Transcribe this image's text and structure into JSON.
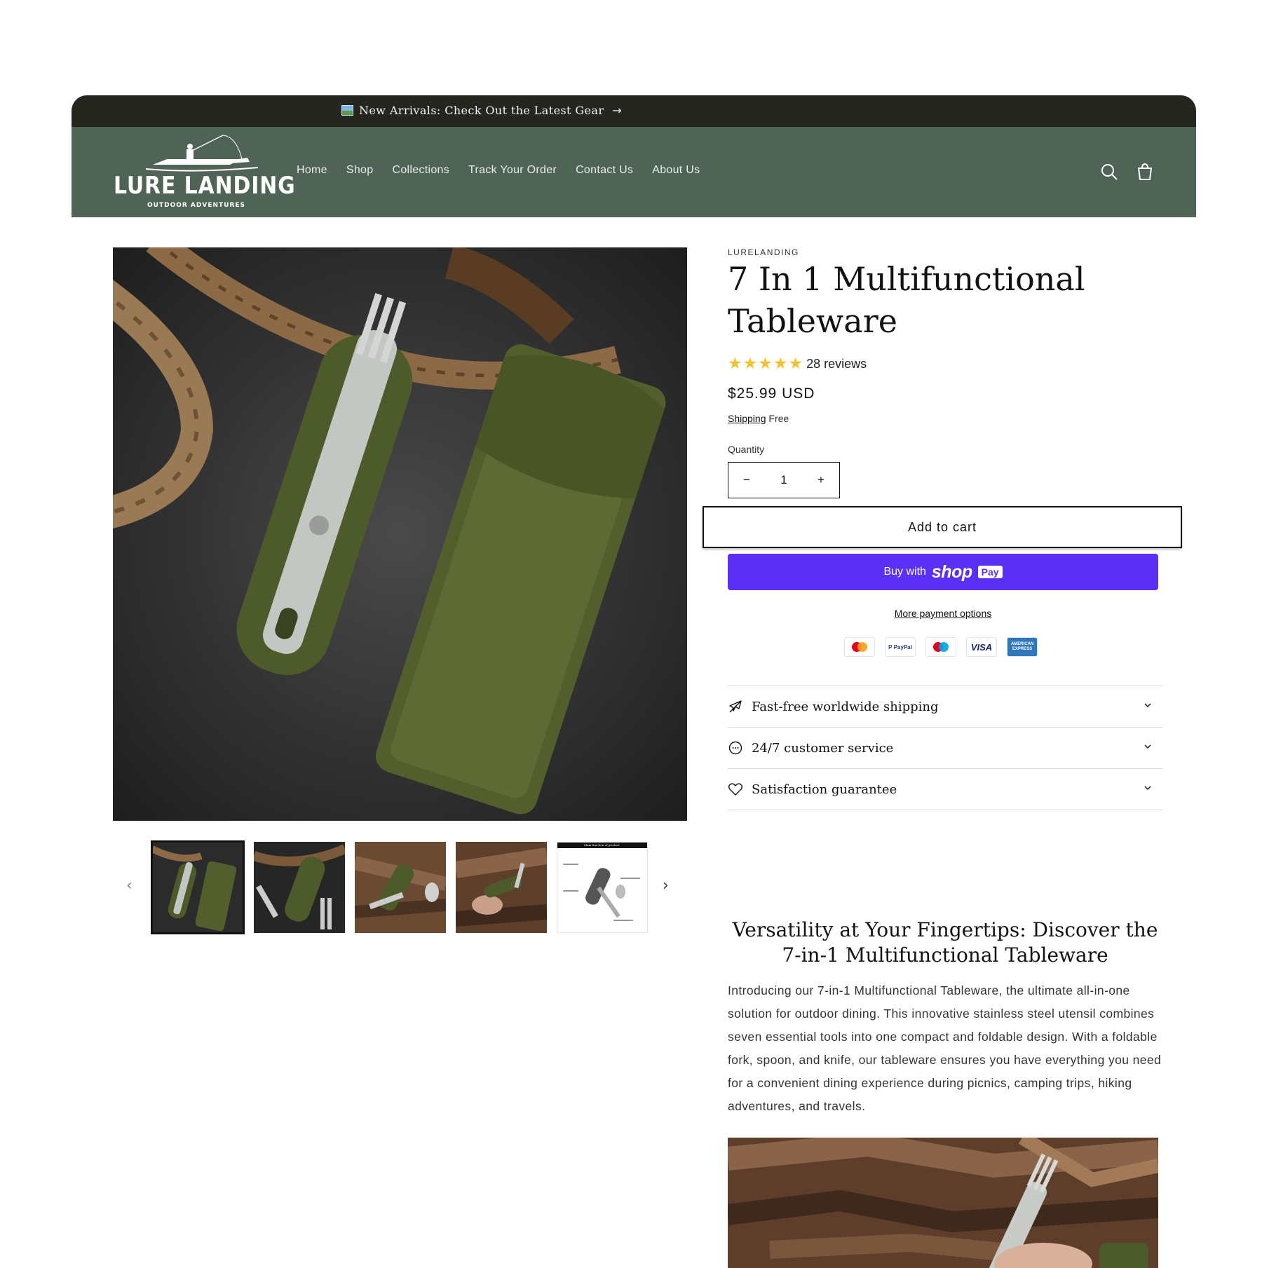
{
  "announcement": {
    "text": "New Arrivals: Check Out the Latest Gear"
  },
  "logo": {
    "title": "LURE LANDING",
    "subtitle": "OUTDOOR ADVENTURES"
  },
  "nav": {
    "items": [
      "Home",
      "Shop",
      "Collections",
      "Track Your Order",
      "Contact Us",
      "About Us"
    ]
  },
  "product": {
    "vendor": "LURELANDING",
    "title": "7 In 1 Multifunctional Tableware",
    "rating": 5,
    "reviews": "28 reviews",
    "price": "$25.99 USD",
    "shipping_link": "Shipping",
    "shipping_value": "Free",
    "quantity_label": "Quantity",
    "quantity": "1",
    "add_to_cart": "Add to cart",
    "buy_with": "Buy with",
    "shop_word": "shop",
    "pay_word": "Pay",
    "more_payment": "More payment options",
    "payment_icons": [
      "mastercard-icon",
      "paypal-icon",
      "maestro-icon",
      "visa-icon",
      "amex-icon"
    ],
    "payment_labels": {
      "paypal": "P PayPal",
      "visa": "VISA",
      "amex": "AMERICAN EXPRESS"
    }
  },
  "accordion": [
    {
      "label": "Fast-free worldwide shipping",
      "icon": "plane-icon"
    },
    {
      "label": "24/7 customer service",
      "icon": "chat-icon"
    },
    {
      "label": "Satisfaction guarantee",
      "icon": "heart-icon"
    }
  ],
  "description": {
    "heading": "Versatility at Your Fingertips: Discover the 7-in-1 Multifunctional Tableware",
    "body": "Introducing our 7-in-1 Multifunctional Tableware, the ultimate all-in-one solution for outdoor dining. This innovative stainless steel utensil combines seven essential tools into one compact and foldable design. With a foldable fork, spoon, and knife, our tableware ensures you have everything you need for a convenient dining experience during picnics, camping trips, hiking adventures, and travels."
  },
  "thumb_caption": "Main function of product",
  "colors": {
    "header": "#4f6356",
    "announce": "#24261f",
    "shop_pay": "#5a31f4",
    "star": "#f2c230",
    "olive": "#4d5a2a"
  }
}
